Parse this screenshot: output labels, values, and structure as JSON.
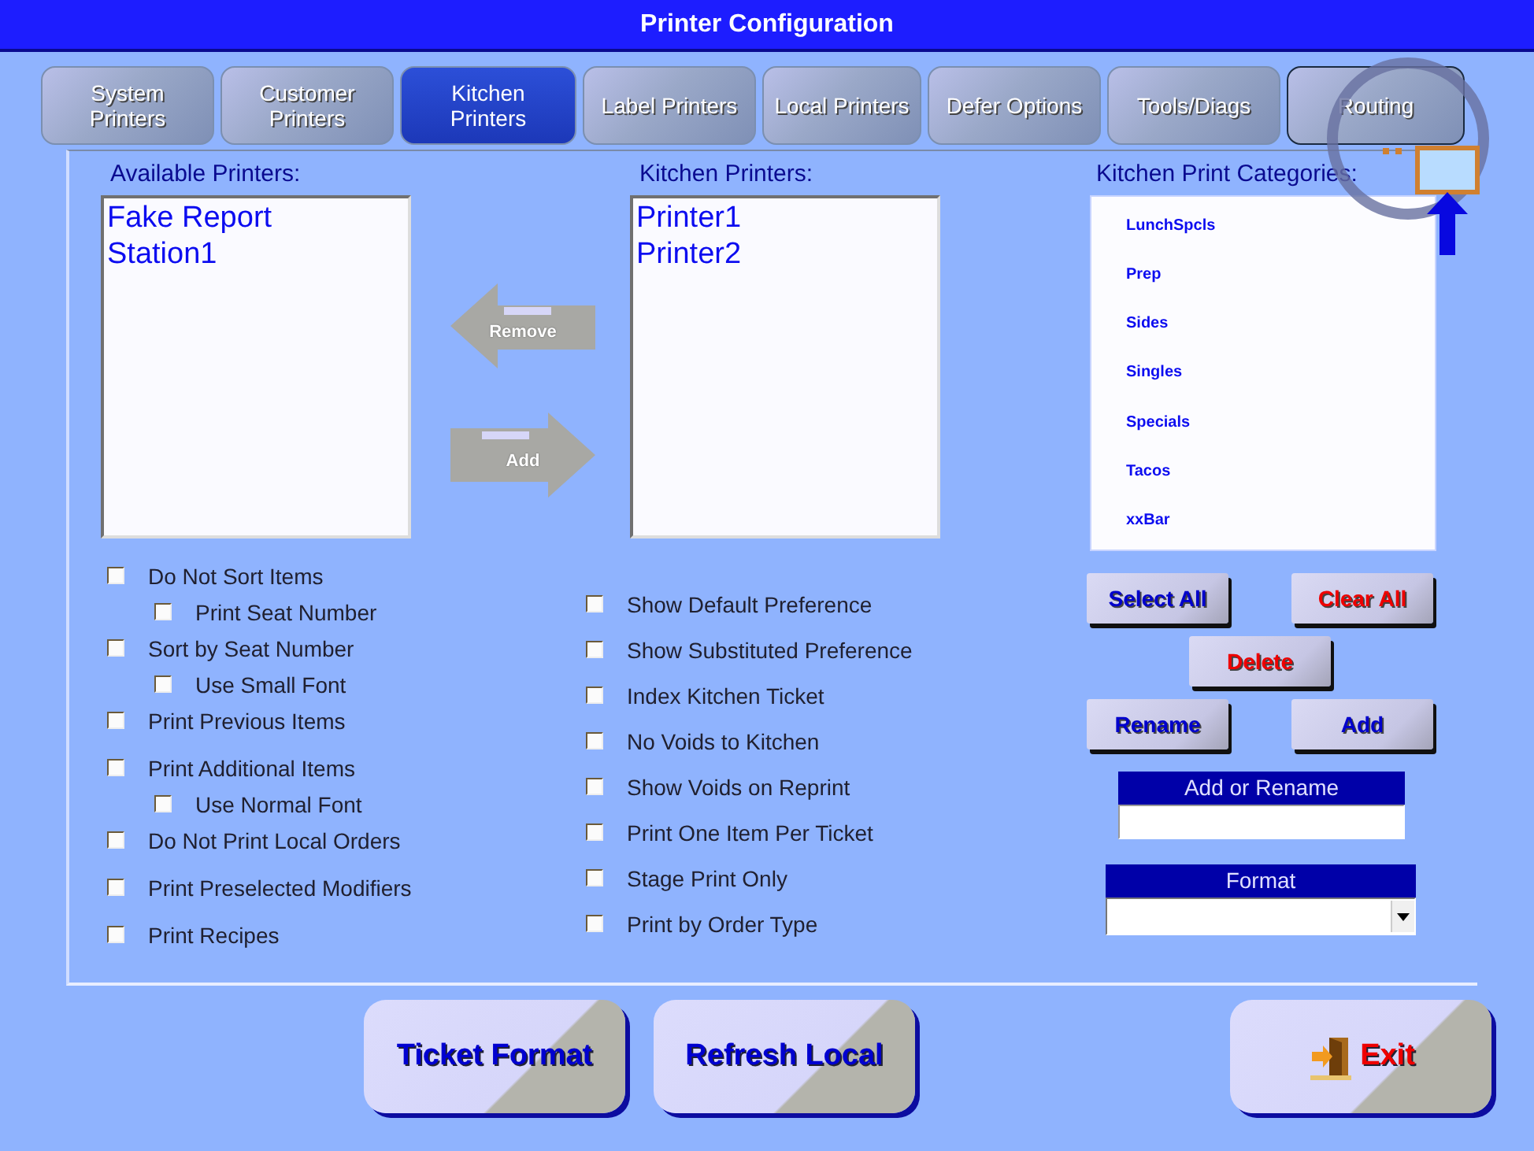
{
  "window": {
    "title": "Printer Configuration"
  },
  "tabs": [
    {
      "label": "System\nPrinters",
      "selected": false
    },
    {
      "label": "Customer\nPrinters",
      "selected": false
    },
    {
      "label": "Kitchen\nPrinters",
      "selected": true
    },
    {
      "label": "Label Printers",
      "selected": false
    },
    {
      "label": "Local Printers",
      "selected": false
    },
    {
      "label": "Defer Options",
      "selected": false
    },
    {
      "label": "Tools/Diags",
      "selected": false
    },
    {
      "label": "Routing",
      "selected": false
    }
  ],
  "available_printers": {
    "label": "Available Printers:",
    "items": [
      "Fake Report",
      "Station1"
    ]
  },
  "transfer_buttons": [
    {
      "kind": "left",
      "label": "Remove"
    },
    {
      "kind": "right",
      "label": "Add"
    }
  ],
  "kitchen_printers": {
    "label": "Kitchen Printers:",
    "items": [
      "Printer1",
      "Printer2"
    ]
  },
  "categories": {
    "label": "Kitchen Print Categories:",
    "items": [
      "LunchSpcls",
      "Prep",
      "Sides",
      "Singles",
      "Specials",
      "Tacos",
      "xxBar"
    ]
  },
  "category_buttons": [
    [
      {
        "label": "Select All",
        "color": "#0000cc"
      },
      {
        "label": "Clear All",
        "color": "#ee0000"
      }
    ],
    [
      {
        "label": "Delete",
        "color": "#ee0000"
      }
    ],
    [
      {
        "label": "Rename",
        "color": "#0000cc"
      },
      {
        "label": "Add",
        "color": "#0000cc"
      }
    ]
  ],
  "name_field": {
    "label": "Add or Rename"
  },
  "format_field": {
    "label": "Format"
  },
  "options_left": [
    {
      "label": "Do Not Sort Items",
      "checked": false,
      "children": [
        {
          "label": "Print Seat Number",
          "checked": false
        }
      ]
    },
    {
      "label": "Sort by Seat Number",
      "checked": false,
      "children": [
        {
          "label": "Use Small Font",
          "checked": false
        }
      ]
    },
    {
      "label": "Print Previous Items",
      "checked": false
    },
    {
      "label": "Print Additional Items",
      "checked": false,
      "children": [
        {
          "label": "Use Normal Font",
          "checked": false
        }
      ]
    },
    {
      "label": "Do Not Print Local Orders",
      "checked": false
    },
    {
      "label": "Print Preselected Modifiers",
      "checked": false
    },
    {
      "label": "Print Recipes",
      "checked": false
    }
  ],
  "options_right": [
    {
      "label": "Show Default Preference",
      "checked": false
    },
    {
      "label": "Show Substituted Preference",
      "checked": false
    },
    {
      "label": "Index Kitchen Ticket",
      "checked": false
    },
    {
      "label": "No Voids to Kitchen",
      "checked": false
    },
    {
      "label": "Show Voids on Reprint",
      "checked": false
    },
    {
      "label": "Print One Item Per Ticket",
      "checked": false
    },
    {
      "label": "Stage Print Only",
      "checked": false
    },
    {
      "label": "Print by Order Type",
      "checked": false
    }
  ],
  "bottom_buttons": [
    {
      "kind": "plain",
      "label": "Ticket Format"
    },
    {
      "kind": "plain",
      "label": "Refresh Local"
    },
    {
      "kind": "exit",
      "label": "Exit"
    }
  ]
}
